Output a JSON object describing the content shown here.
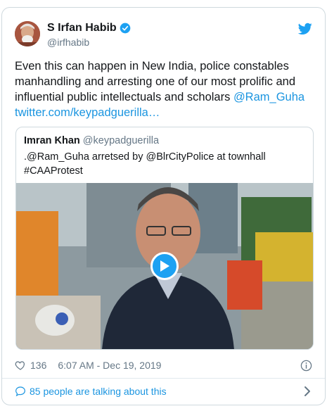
{
  "author": {
    "name": "S Irfan Habib",
    "handle": "@irfhabib",
    "avatar": "avatar-photo",
    "verified": true
  },
  "tweet": {
    "text_plain": "Even this can happen in New India, police constables manhandling and arresting one of our most prolific and influential public intellectuals and scholars ",
    "mention": "@Ram_Guha",
    "link": "twitter.com/keypadguerilla…"
  },
  "quoted": {
    "name": "Imran Khan",
    "handle": "@keypadguerilla",
    "text_line1": ".@Ram_Guha arretsed by @BlrCityPolice at townhall",
    "text_line2": "#CAAProtest",
    "media": "video-thumbnail-man-in-vest-outdoors"
  },
  "meta": {
    "likes": "136",
    "timestamp": "6:07 AM - Dec 19, 2019"
  },
  "footer": {
    "talking": "85 people are talking about this"
  },
  "icons": {
    "bird": "twitter-bird-icon",
    "verified": "verified-badge-icon",
    "heart": "heart-icon",
    "info": "info-icon",
    "bubble": "speech-bubble-icon",
    "chevron": "chevron-right-icon",
    "play": "play-icon"
  },
  "colors": {
    "accent": "#1da1f2",
    "link": "#1b95e0",
    "muted": "#657786",
    "border": "#cfd9de"
  }
}
